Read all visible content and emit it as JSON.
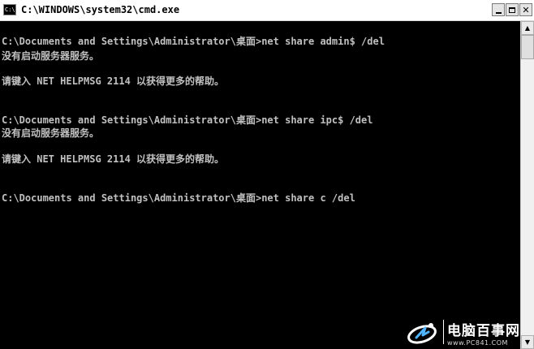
{
  "window": {
    "icon_text": "C:\\",
    "title": "C:\\WINDOWS\\system32\\cmd.exe"
  },
  "console": {
    "lines": [
      "C:\\Documents and Settings\\Administrator\\桌面>net share admin$ /del",
      "没有启动服务器服务。",
      "请键入 NET HELPMSG 2114 以获得更多的帮助。",
      "C:\\Documents and Settings\\Administrator\\桌面>net share ipc$ /del",
      "没有启动服务器服务。",
      "请键入 NET HELPMSG 2114 以获得更多的帮助。",
      "C:\\Documents and Settings\\Administrator\\桌面>net share c /del"
    ],
    "text_color": "#c0c0c0",
    "background": "#000000"
  },
  "watermark": {
    "brand": "电脑百事网",
    "url": "www.PC841.COM"
  }
}
